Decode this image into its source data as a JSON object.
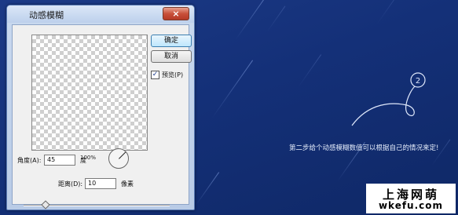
{
  "dialog": {
    "title": "动感模糊",
    "close_label": "×",
    "ok_label": "确定",
    "cancel_label": "取消",
    "preview_checkbox": {
      "checked": true,
      "mark": "✓",
      "label": "预览(P)"
    },
    "zoom": {
      "minus": "−",
      "plus": "+",
      "level": "100%"
    },
    "angle": {
      "label": "角度(A):",
      "value": "45",
      "unit": "度"
    },
    "distance": {
      "label": "距离(D):",
      "value": "10",
      "unit": "像素"
    }
  },
  "annotation": {
    "step_number": "2",
    "caption": "第二步给个动感模糊数值可以根据自己的情况来定!"
  },
  "watermark": {
    "line1": "上海网萌",
    "line2": "wkefu.com"
  },
  "colors": {
    "background": "#143078",
    "caption": "#e6eefc"
  }
}
